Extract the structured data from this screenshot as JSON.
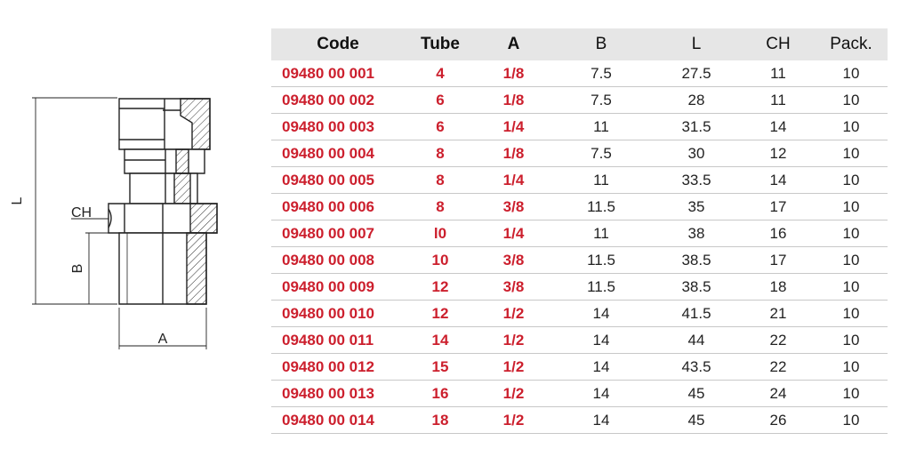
{
  "drawing": {
    "labels": {
      "L": "L",
      "CH": "CH",
      "B": "B",
      "A": "A"
    }
  },
  "table": {
    "headers": [
      "Code",
      "Tube",
      "A",
      "B",
      "L",
      "CH",
      "Pack."
    ],
    "rows": [
      [
        "09480 00 001",
        "4",
        "1/8",
        "7.5",
        "27.5",
        "11",
        "10"
      ],
      [
        "09480 00 002",
        "6",
        "1/8",
        "7.5",
        "28",
        "11",
        "10"
      ],
      [
        "09480 00 003",
        "6",
        "1/4",
        "11",
        "31.5",
        "14",
        "10"
      ],
      [
        "09480 00 004",
        "8",
        "1/8",
        "7.5",
        "30",
        "12",
        "10"
      ],
      [
        "09480 00 005",
        "8",
        "1/4",
        "11",
        "33.5",
        "14",
        "10"
      ],
      [
        "09480 00 006",
        "8",
        "3/8",
        "11.5",
        "35",
        "17",
        "10"
      ],
      [
        "09480 00 007",
        "l0",
        "1/4",
        "11",
        "38",
        "16",
        "10"
      ],
      [
        "09480 00 008",
        "10",
        "3/8",
        "11.5",
        "38.5",
        "17",
        "10"
      ],
      [
        "09480 00 009",
        "12",
        "3/8",
        "11.5",
        "38.5",
        "18",
        "10"
      ],
      [
        "09480 00 010",
        "12",
        "1/2",
        "14",
        "41.5",
        "21",
        "10"
      ],
      [
        "09480 00 011",
        "14",
        "1/2",
        "14",
        "44",
        "22",
        "10"
      ],
      [
        "09480 00 012",
        "15",
        "1/2",
        "14",
        "43.5",
        "22",
        "10"
      ],
      [
        "09480 00 013",
        "16",
        "1/2",
        "14",
        "45",
        "24",
        "10"
      ],
      [
        "09480 00 014",
        "18",
        "1/2",
        "14",
        "45",
        "26",
        "10"
      ]
    ]
  },
  "colors": {
    "accent_red": "#cc1f2d",
    "header_bg": "#e6e6e6",
    "rule": "#c8c8c8"
  }
}
